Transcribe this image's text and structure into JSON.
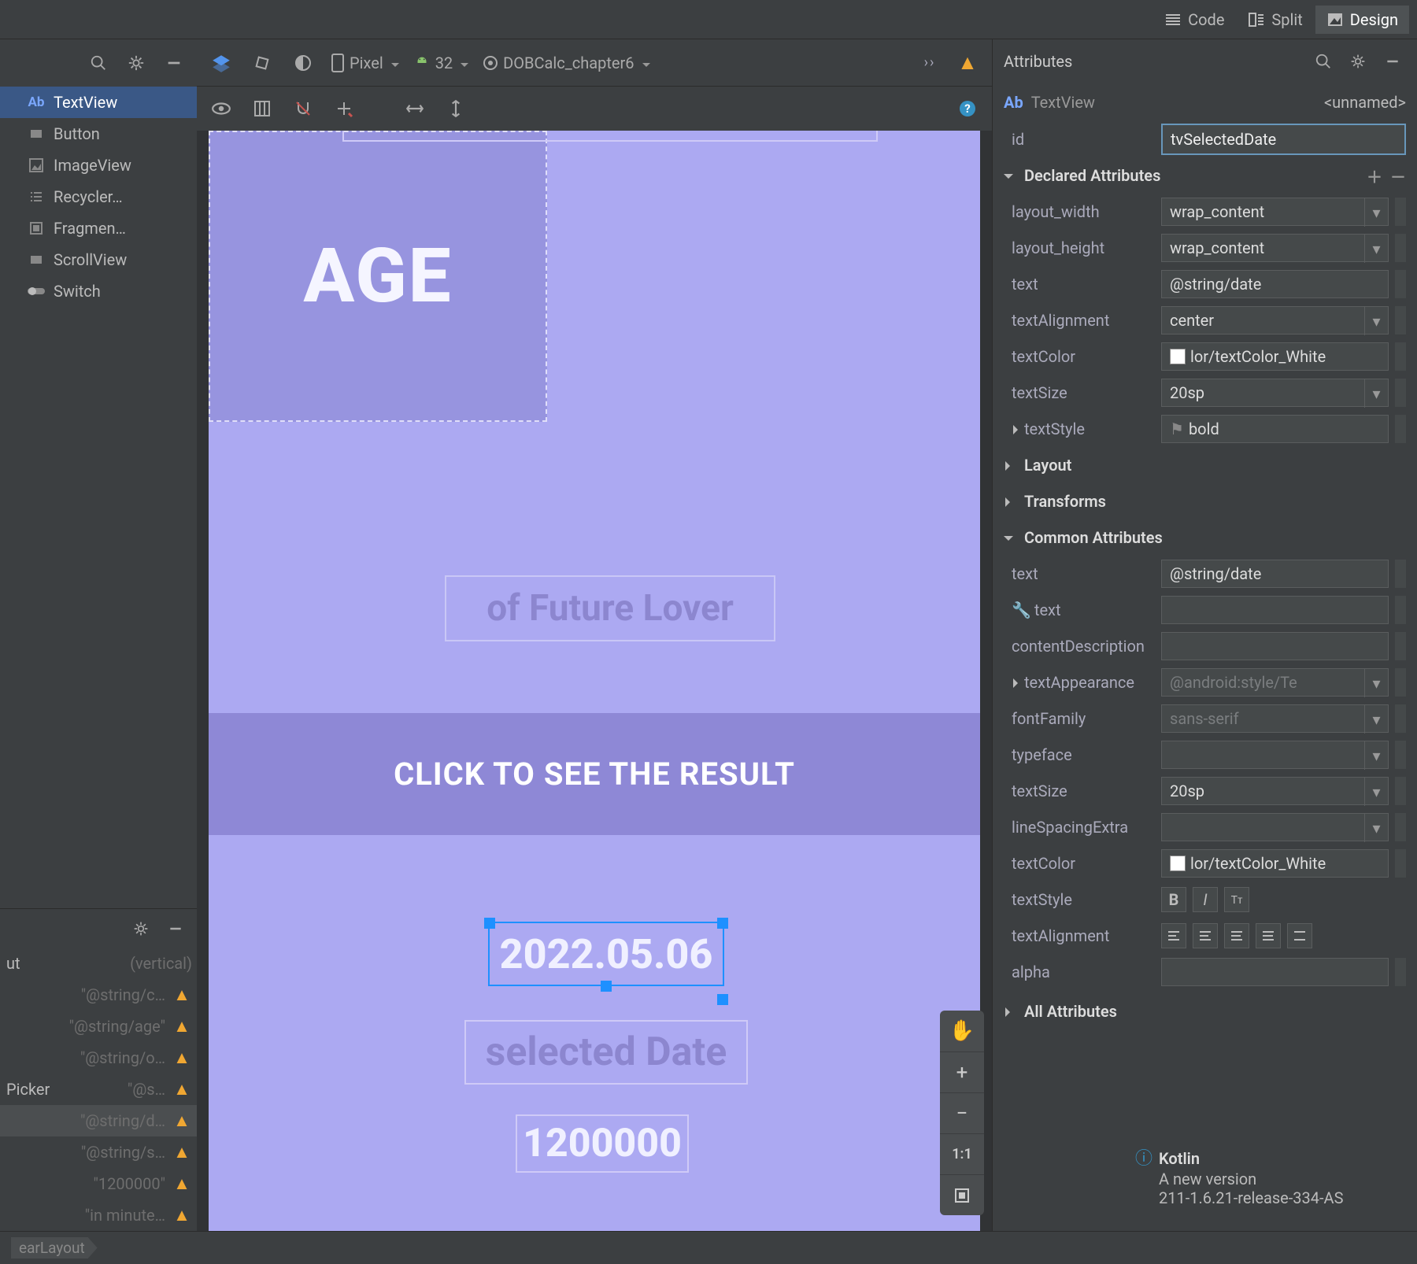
{
  "viewTabs": {
    "code": "Code",
    "split": "Split",
    "design": "Design",
    "active": "Design"
  },
  "palette": {
    "items": [
      {
        "label": "TextView",
        "icon": "ab"
      },
      {
        "label": "Button",
        "icon": "rect"
      },
      {
        "label": "ImageView",
        "icon": "image"
      },
      {
        "label": "Recycler…",
        "icon": "list"
      },
      {
        "label": "Fragmen…",
        "icon": "frag"
      },
      {
        "label": "ScrollView",
        "icon": "rect"
      },
      {
        "label": "Switch",
        "icon": "switch"
      }
    ],
    "selectedIndex": 0
  },
  "designToolbar": {
    "device": "Pixel",
    "api": "32",
    "theme": "DOBCalc_chapter6"
  },
  "componentTree": {
    "root": {
      "label": "ut",
      "hint": "(vertical)"
    },
    "rows": [
      {
        "label": "",
        "hint": "\"@string/c…",
        "warn": true
      },
      {
        "label": "",
        "hint": "\"@string/age\"",
        "warn": true
      },
      {
        "label": "",
        "hint": "\"@string/o…",
        "warn": true
      },
      {
        "label": "Picker",
        "hint": "\"@s…",
        "warn": true
      },
      {
        "label": "",
        "hint": "\"@string/d…",
        "warn": true,
        "sel": true
      },
      {
        "label": "",
        "hint": "\"@string/s…",
        "warn": true
      },
      {
        "label": "",
        "hint": "\"1200000\"",
        "warn": true
      },
      {
        "label": "",
        "hint": "\"in minute…",
        "warn": true
      }
    ]
  },
  "preview": {
    "ageText": "AGE",
    "subtitle": "of Future Lover",
    "buttonText": "CLICK TO SEE THE RESULT",
    "date": "2022.05.06",
    "selectedDateLabel": "selected Date",
    "minutes": "1200000"
  },
  "zoom": {
    "pan": "✋",
    "plus": "+",
    "minus": "−",
    "fit": "1:1",
    "frame": "▣"
  },
  "attributes": {
    "panelTitle": "Attributes",
    "componentType": "TextView",
    "componentName": "<unnamed>",
    "idLabel": "id",
    "idValue": "tvSelectedDate",
    "sections": {
      "declared": "Declared Attributes",
      "layout": "Layout",
      "transforms": "Transforms",
      "common": "Common Attributes",
      "all": "All Attributes"
    },
    "declared": [
      {
        "name": "layout_width",
        "value": "wrap_content",
        "dd": true
      },
      {
        "name": "layout_height",
        "value": "wrap_content",
        "dd": true
      },
      {
        "name": "text",
        "value": "@string/date"
      },
      {
        "name": "textAlignment",
        "value": "center",
        "dd": true
      },
      {
        "name": "textColor",
        "value": "lor/textColor_White",
        "swatch": true
      },
      {
        "name": "textSize",
        "value": "20sp",
        "dd": true
      },
      {
        "name": "textStyle",
        "value": "bold",
        "flag": true,
        "caret": true
      }
    ],
    "common": [
      {
        "name": "text",
        "value": "@string/date",
        "box": true
      },
      {
        "name": "text",
        "value": "",
        "wrench": true
      },
      {
        "name": "contentDescription",
        "value": ""
      },
      {
        "name": "textAppearance",
        "value": "@android:style/Te",
        "dd": true,
        "ghost": true,
        "caret": true
      },
      {
        "name": "fontFamily",
        "value": "sans-serif",
        "dd": true,
        "ghost": true
      },
      {
        "name": "typeface",
        "value": "",
        "dd": true
      },
      {
        "name": "textSize",
        "value": "20sp",
        "dd": true
      },
      {
        "name": "lineSpacingExtra",
        "value": "",
        "dd": true
      },
      {
        "name": "textColor",
        "value": "lor/textColor_White",
        "swatch": true
      },
      {
        "name": "textStyle",
        "special": "BIT"
      },
      {
        "name": "textAlignment",
        "special": "align"
      },
      {
        "name": "alpha",
        "value": ""
      }
    ]
  },
  "kotlinToast": {
    "title": "Kotlin",
    "line1": "A new version",
    "line2": "211-1.6.21-release-334-AS"
  },
  "footer": {
    "breadcrumb": "earLayout"
  }
}
